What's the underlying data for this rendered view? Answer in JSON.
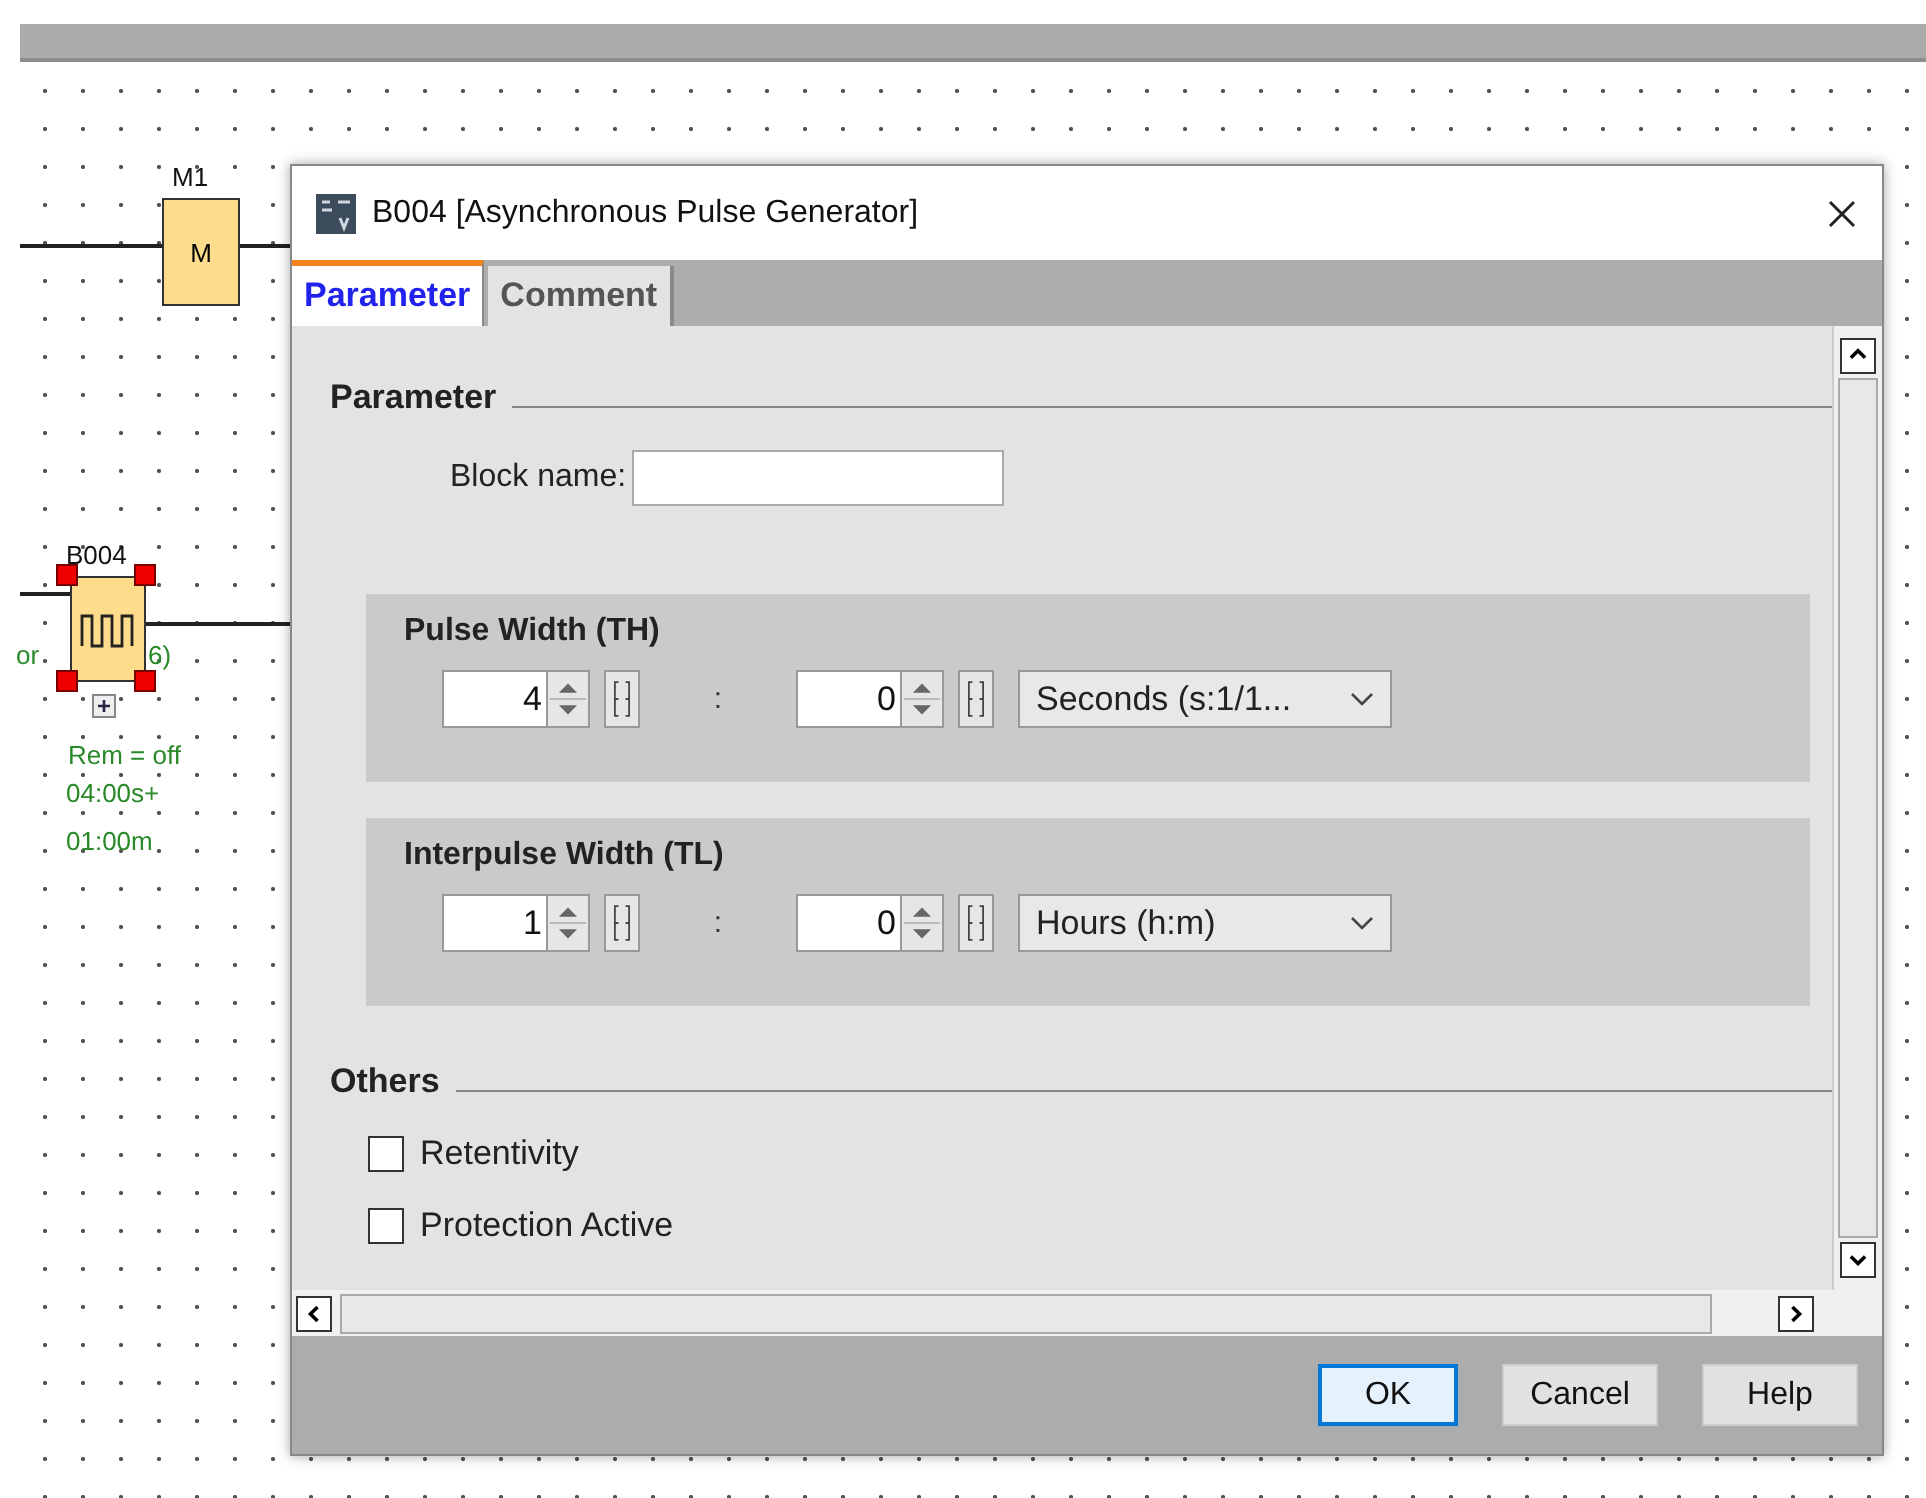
{
  "diagram": {
    "blocks": [
      {
        "kind": "memory",
        "label": "M1",
        "symbol": "M",
        "selected": false
      },
      {
        "kind": "pulse",
        "label": "B004",
        "selected": true
      }
    ],
    "annotations": [
      "or",
      "6)",
      "Rem = off",
      "04:00s+",
      "01:00m"
    ]
  },
  "window": {
    "title": "B004 [Asynchronous Pulse Generator]"
  },
  "tabs": [
    {
      "label": "Parameter",
      "selected": true
    },
    {
      "label": "Comment",
      "selected": false
    }
  ],
  "parameter": {
    "title": "Parameter",
    "block_name": {
      "label": "Block name:"
    }
  },
  "groups": [
    {
      "title": "Pulse Width (TH)",
      "value_1": "4",
      "separator": ":",
      "value_2": "0",
      "unit": "Seconds (s:1/1..."
    },
    {
      "title": "Interpulse Width (TL)",
      "value_1": "1",
      "separator": ":",
      "value_2": "0",
      "unit": "Hours (h:m)"
    }
  ],
  "others": {
    "title": "Others",
    "checkboxes": [
      {
        "label": "Retentivity",
        "checked": false
      },
      {
        "label": "Protection Active",
        "checked": false
      }
    ]
  },
  "buttons": [
    {
      "label": "OK",
      "focused": true
    },
    {
      "label": "Cancel",
      "focused": false
    },
    {
      "label": "Help",
      "focused": false
    }
  ]
}
